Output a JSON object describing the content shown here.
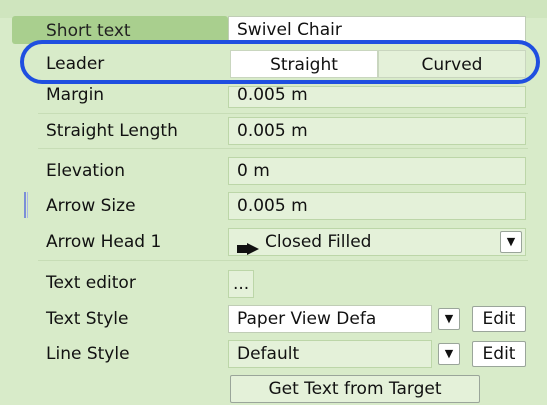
{
  "rows": {
    "short_text": {
      "label": "Short text",
      "value": "Swivel Chair"
    },
    "leader": {
      "label": "Leader",
      "options": [
        "Straight",
        "Curved"
      ],
      "selected": "Straight"
    },
    "margin": {
      "label": "Margin",
      "value": "0.005 m"
    },
    "straight_length": {
      "label": "Straight Length",
      "value": "0.005 m"
    },
    "elevation": {
      "label": "Elevation",
      "value": "0 m"
    },
    "arrow_size": {
      "label": "Arrow Size",
      "value": "0.005 m"
    },
    "arrow_head_1": {
      "label": "Arrow Head 1",
      "value": "Closed Filled",
      "icon": "closed-filled-arrow-icon"
    },
    "text_editor": {
      "label": "Text editor",
      "value": "..."
    },
    "text_style": {
      "label": "Text Style",
      "value": "Paper View Defa",
      "button": "Edit"
    },
    "line_style": {
      "label": "Line Style",
      "value": "Default",
      "button": "Edit"
    },
    "get_text": {
      "button": "Get Text from Target"
    }
  },
  "colors": {
    "panel_bg": "#d8ebc9",
    "field_bg": "#e4f1d9",
    "highlight_ring": "#1f4fe0",
    "drag_handle": "#7b8fd6"
  }
}
